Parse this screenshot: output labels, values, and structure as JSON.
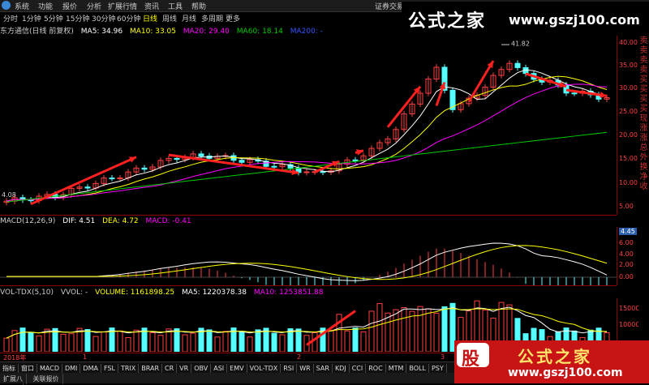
{
  "menu": {
    "items": [
      "系统",
      "功能",
      "报价",
      "分析",
      "扩展行情",
      "资讯",
      "工具",
      "帮助"
    ],
    "securities_title": "证券交易"
  },
  "periods": {
    "items": [
      "分时",
      "1分钟",
      "5分钟",
      "15分钟",
      "30分钟",
      "60分钟",
      "日线",
      "周线",
      "月线",
      "多周期",
      "更多"
    ],
    "active": "日线"
  },
  "price_pane": {
    "stock": "东方通信(日线 前复权)",
    "ma5": "MA5: 34.96",
    "ma10": "MA10: 33.05",
    "ma20": "MA20: 29.40",
    "ma60": "MA60: 18.14",
    "ma200": "MA200: -",
    "high_label": "41.82",
    "low_label": "4.08",
    "ticks": [
      "40.00",
      "35.00",
      "30.00",
      "25.00",
      "20.00",
      "15.00",
      "10.00",
      "5.00"
    ],
    "colors": {
      "ma5": "#ffffff",
      "ma10": "#ffff00",
      "ma20": "#ff00ff",
      "ma60": "#00cc00",
      "ma200": "#3355ff",
      "up": "#ff4040",
      "down": "#54ffff",
      "arrow": "#ff2020"
    }
  },
  "macd_pane": {
    "title": "MACD(12,26,9)",
    "dif": "DIF: 4.51",
    "dea": "DEA: 4.72",
    "macd": "MACD: -0.41",
    "current": "4.45",
    "ticks": [
      "6.00",
      "4.00",
      "2.00",
      "0.00"
    ]
  },
  "vol_pane": {
    "title": "VOL-TDX(5,10)",
    "vvol": "VVOL: -",
    "volume": "VOLUME: 1161898.25",
    "ma5": "MA5: 1220378.38",
    "ma10": "MA10: 1253851.88",
    "ticks": [
      "15000",
      "10000"
    ]
  },
  "timeline": {
    "year": "2018年",
    "m1": "1",
    "m2": "2",
    "m3": "3"
  },
  "tabs": [
    "指标",
    "窗口",
    "MACD",
    "DMI",
    "DMA",
    "FSL",
    "TRIX",
    "BRAR",
    "CR",
    "VR",
    "OBV",
    "ASI",
    "EMV",
    "VOL-TDX",
    "RSI",
    "WR",
    "SAR",
    "KDJ",
    "CCI",
    "ROC",
    "MTM",
    "BOLL",
    "PSY",
    "MCST"
  ],
  "bottom": [
    "扩展八",
    "关联报价"
  ],
  "side_chars": [
    "卖",
    "卖",
    "卖",
    "卖",
    "买",
    "买",
    "买",
    "买",
    "现",
    "涨",
    "涨",
    "总",
    "外",
    "换",
    "净",
    "收"
  ],
  "watermark": {
    "top_text": "公式之家",
    "top_url": "www.gszj100.com",
    "seal": "股",
    "bottom_text": "公式之家",
    "bottom_url": "www.gszj100.com"
  }
}
